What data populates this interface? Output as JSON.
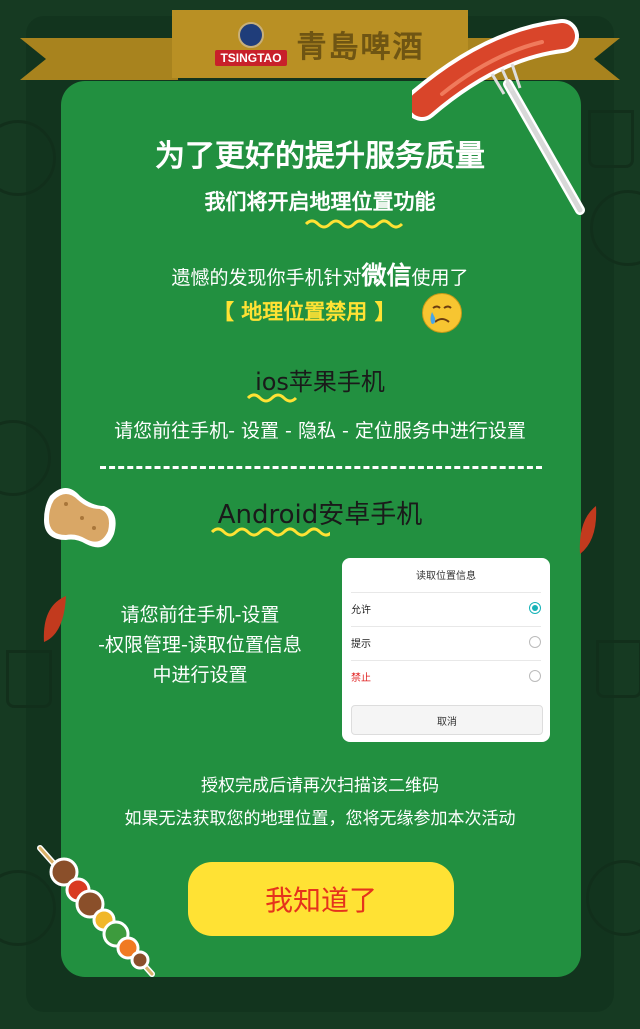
{
  "brand": {
    "logo_text": "TSINGTAO",
    "name_cn": "青島啤酒"
  },
  "headline": {
    "line1": "为了更好的提升服务质量",
    "line2": "我们将开启地理位置功能",
    "line3_prefix": "遗憾的发现你手机针对",
    "line3_app": "微信",
    "line3_suffix": "使用了",
    "status": "【 地理位置禁用 】"
  },
  "ios": {
    "heading": "ios苹果手机",
    "instruction": "请您前往手机- 设置 - 隐私 - 定位服务中进行设置"
  },
  "android": {
    "heading": "Android安卓手机",
    "instruction_line1": "请您前往手机-设置",
    "instruction_line2": "-权限管理-读取位置信息",
    "instruction_line3": "中进行设置"
  },
  "dialog": {
    "title": "读取位置信息",
    "options": [
      {
        "label": "允许",
        "selected": true,
        "color": "#222222"
      },
      {
        "label": "提示",
        "selected": false,
        "color": "#222222"
      },
      {
        "label": "禁止",
        "selected": false,
        "color": "#e02020"
      }
    ],
    "cancel_label": "取消"
  },
  "notes": {
    "line1": "授权完成后请再次扫描该二维码",
    "line2": "如果无法获取您的地理位置，您将无缘参加本次活动"
  },
  "confirm_button": {
    "label": "我知道了"
  },
  "colors": {
    "card": "#229040",
    "accent_yellow": "#ffe234",
    "button_text": "#e5331c",
    "background": "#163a22"
  },
  "icons": [
    "sausage-fork-icon",
    "peanut-icon",
    "skewer-icon",
    "crying-face-icon",
    "radio-icon"
  ]
}
